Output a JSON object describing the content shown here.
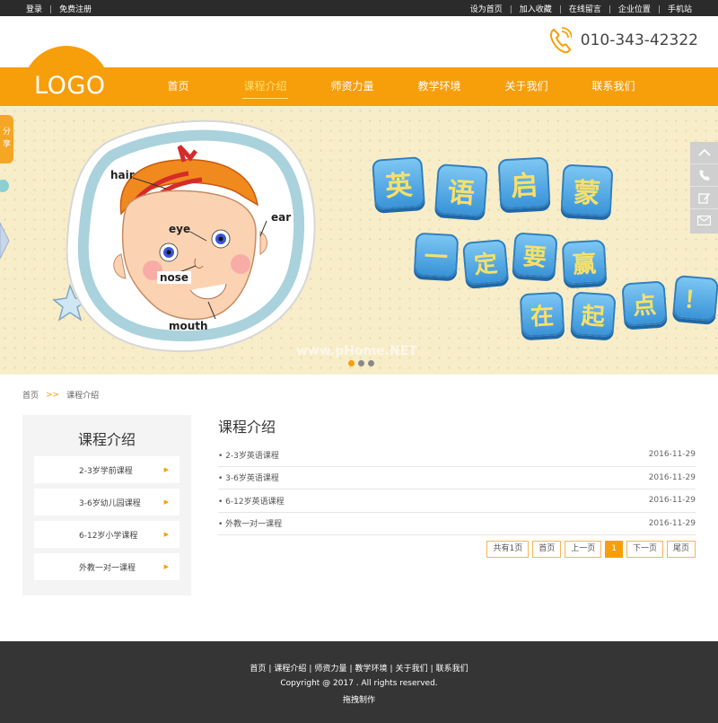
{
  "topbar": {
    "left": [
      "登录",
      "免费注册"
    ],
    "right": [
      "设为首页",
      "加入收藏",
      "在线留言",
      "企业位置",
      "手机站"
    ]
  },
  "header": {
    "phone": "010-343-42322",
    "logo": "LOGO"
  },
  "nav": {
    "items": [
      "首页",
      "课程介绍",
      "师资力量",
      "教学环境",
      "关于我们",
      "联系我们"
    ],
    "active_index": 1
  },
  "banner": {
    "share": "分享",
    "face_labels": {
      "hair": "hair",
      "eye": "eye",
      "ear": "ear",
      "nose": "nose",
      "mouth": "mouth"
    },
    "line1": [
      "英",
      "语",
      "启",
      "蒙"
    ],
    "line2": [
      "一",
      "定",
      "要",
      "赢"
    ],
    "line3": [
      "在",
      "起",
      "点",
      "！"
    ],
    "watermark": "www.pHome.NET",
    "slide_count": 3,
    "active_slide": 0
  },
  "breadcrumb": {
    "home": "首页",
    "arrow": ">>",
    "current": "课程介绍"
  },
  "sidebar": {
    "title": "课程介绍",
    "items": [
      "2-3岁学前课程",
      "3-6岁幼儿园课程",
      "6-12岁小学课程",
      "外教一对一课程"
    ]
  },
  "main": {
    "title": "课程介绍",
    "rows": [
      {
        "title": "2-3岁英语课程",
        "date": "2016-11-29"
      },
      {
        "title": "3-6岁英语课程",
        "date": "2016-11-29"
      },
      {
        "title": "6-12岁英语课程",
        "date": "2016-11-29"
      },
      {
        "title": "外教一对一课程",
        "date": "2016-11-29"
      }
    ],
    "pager": {
      "total": "共有1页",
      "first": "首页",
      "prev": "上一页",
      "current": "1",
      "next": "下一页",
      "last": "尾页"
    }
  },
  "footer": {
    "links": [
      "首页",
      "课程介绍",
      "师资力量",
      "教学环境",
      "关于我们",
      "联系我们"
    ],
    "copyright": "Copyright @ 2017 . All rights reserved.",
    "credit": "拖拽制作"
  },
  "colors": {
    "accent": "#f79e0b",
    "dark": "#2b2b2b",
    "footer": "#353535"
  }
}
